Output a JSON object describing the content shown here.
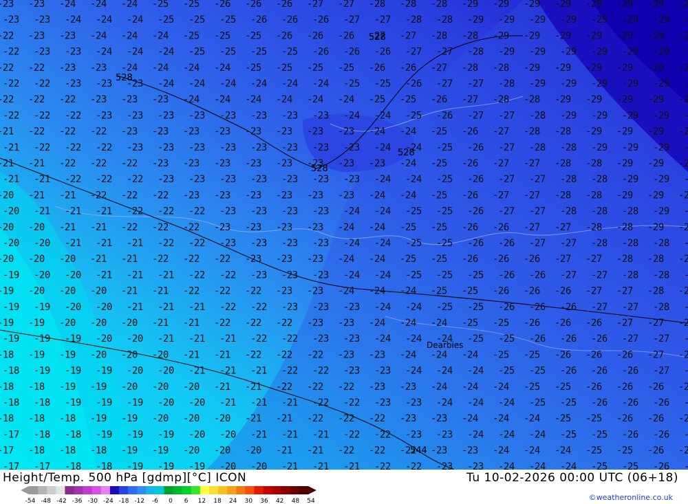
{
  "map": {
    "title": "Height/Temp. 500 hPa [gdmp][°C] ICON",
    "datetime": "Tu 10-02-2026 00:00 UTC (06+18)",
    "credit": "©weatheronline.co.uk",
    "height_labels": [
      "528",
      "528",
      "528",
      "528",
      "544"
    ],
    "place_label": "Dearbies"
  },
  "legend": {
    "ticks": [
      "-54",
      "-48",
      "-42",
      "-36",
      "-30",
      "-24",
      "-18",
      "-12",
      "-6",
      "0",
      "6",
      "12",
      "18",
      "24",
      "30",
      "36",
      "42",
      "48",
      "54"
    ],
    "colors": [
      "#9a9a9a",
      "#b4b4b4",
      "#cdcdcd",
      "#e3e3e3",
      "#8a2c8e",
      "#a333b0",
      "#c03cd0",
      "#d850e6",
      "#e880f0",
      "#1a0dbe",
      "#2a40ea",
      "#2f6cf4",
      "#2f8ef4",
      "#17b4ee",
      "#00c8d8",
      "#009e2a",
      "#00b82a",
      "#00d228",
      "#36e626",
      "#ffff40",
      "#f8e030",
      "#f8c020",
      "#f8a018",
      "#f87810",
      "#f85008",
      "#e81800",
      "#c80000",
      "#a80000",
      "#880000",
      "#6c0000",
      "#500000"
    ]
  }
}
